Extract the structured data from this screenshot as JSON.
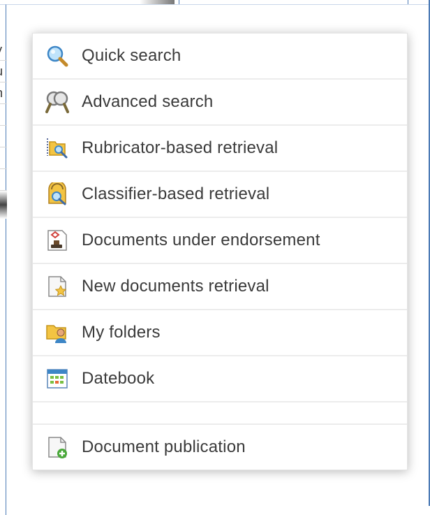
{
  "menu": {
    "items": [
      {
        "label": "Quick search",
        "icon": "quick-search-icon"
      },
      {
        "label": "Advanced search",
        "icon": "advanced-search-icon"
      },
      {
        "label": "Rubricator-based retrieval",
        "icon": "rubricator-icon"
      },
      {
        "label": "Classifier-based retrieval",
        "icon": "classifier-icon"
      },
      {
        "label": "Documents under endorsement",
        "icon": "endorsement-icon"
      },
      {
        "label": "New documents retrieval",
        "icon": "new-documents-icon"
      },
      {
        "label": "My folders",
        "icon": "my-folders-icon"
      },
      {
        "label": "Datebook",
        "icon": "datebook-icon"
      },
      {
        "label": "",
        "icon": ""
      },
      {
        "label": "Document publication",
        "icon": "document-publication-icon"
      }
    ]
  },
  "background": {
    "left_fragments": [
      "y",
      "u",
      "n"
    ]
  },
  "colors": {
    "accent_blue": "#4b7ab5",
    "folder_yellow": "#f0c040",
    "text": "#3a3a3a"
  }
}
